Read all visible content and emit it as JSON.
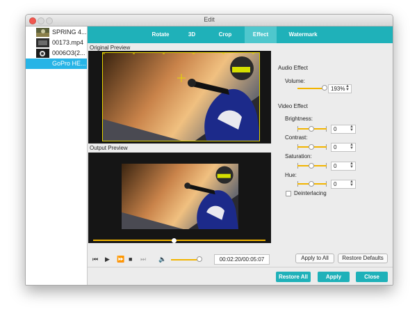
{
  "window": {
    "title": "Edit"
  },
  "files": [
    {
      "label": "SPRING 4...",
      "selected": false
    },
    {
      "label": "00173.mp4",
      "selected": false
    },
    {
      "label": "0006O3(2...",
      "selected": false
    },
    {
      "label": "GoPro HE...",
      "selected": true
    }
  ],
  "tabs": [
    {
      "label": "Rotate",
      "active": false
    },
    {
      "label": "3D",
      "active": false
    },
    {
      "label": "Crop",
      "active": false
    },
    {
      "label": "Effect",
      "active": true
    },
    {
      "label": "Watermark",
      "active": false
    }
  ],
  "preview": {
    "original_label": "Original Preview",
    "output_label": "Output Preview",
    "seek_position": 0.47,
    "time": "00:02:20/00:05:07",
    "volume_level": 0.85
  },
  "audio": {
    "title": "Audio Effect",
    "volume_label": "Volume:",
    "volume_value": "193%"
  },
  "video": {
    "title": "Video Effect",
    "brightness_label": "Brightness:",
    "brightness_value": "0",
    "contrast_label": "Contrast:",
    "contrast_value": "0",
    "saturation_label": "Saturation:",
    "saturation_value": "0",
    "hue_label": "Hue:",
    "hue_value": "0",
    "deinterlacing_label": "Deinterlacing",
    "deinterlacing_checked": false
  },
  "buttons": {
    "apply_to_all": "Apply to All",
    "restore_defaults": "Restore Defaults",
    "restore_all": "Restore All",
    "apply": "Apply",
    "close": "Close"
  },
  "colors": {
    "accent": "#1fb1b9",
    "selection": "#27b4e6",
    "slider": "#f2b400"
  }
}
